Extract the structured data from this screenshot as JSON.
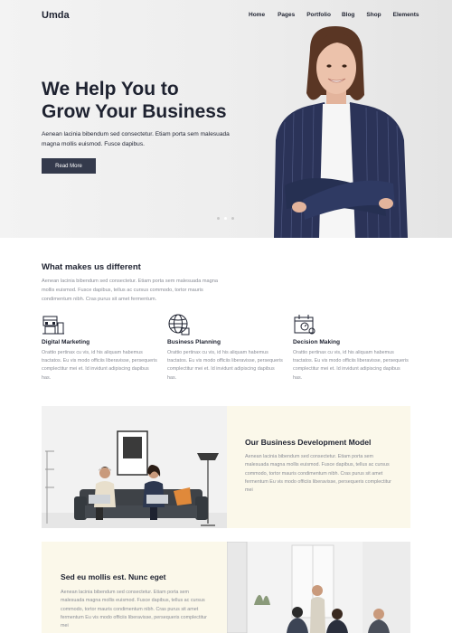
{
  "brand": {
    "logo": "Umda"
  },
  "nav": {
    "items": [
      "Home",
      "Pages",
      "Portfolio",
      "Blog",
      "Shop",
      "Elements"
    ]
  },
  "hero": {
    "title_line1": "We Help You to",
    "title_line2": "Grow Your Business",
    "description": "Aenean lacinia bibendum sed consectetur. Etiam porta sem malesuada magna mollis euismod. Fusce dapibus.",
    "button_label": "Read More"
  },
  "features_section": {
    "title": "What makes us different",
    "description": "Aenean lacinia bibendum sed consectetur. Etiam porta sem malesuada magna mollis euismod. Fusce dapibus, tellus ac cursus commodo, tortor mauris condimentum nibh. Cras purus sit amet fermentum.",
    "items": [
      {
        "title": "Digital Marketing",
        "icon": "store-icon",
        "description": "Orattio pertinax cu vis, id his aliquam habemus tractatos. Eu vis modo officiis liberavisse, persequeris complectitur mei et. Id invidunt adipiscing dapibus has."
      },
      {
        "title": "Business Planning",
        "icon": "globe-icon",
        "description": "Orattio pertinax cu vis, id his aliquam habemus tractatos. Eu vis modo officiis liberavisse, persequeris complectitur mei et. Id invidunt adipiscing dapibus has."
      },
      {
        "title": "Decision Making",
        "icon": "calendar-icon",
        "description": "Orattio pertinax cu vis, id his aliquam habemus tractatos. Eu vis modo officiis liberavisse, persequeris complectitur mei et. Id invidunt adipiscing dapibus has."
      }
    ]
  },
  "block1": {
    "title": "Our Business Development Model",
    "description": "Aenean lacinia bibendum sed consectetur. Etiam porta sem malesuada magna mollis euismod. Fusce dapibus, tellus ac cursus commodo, tortor mauris condimentum nibh. Cras purus sit amet fermentum Eu vis modo officiis liberavisse, persequeris complectitur mei"
  },
  "block2": {
    "title": "Sed eu mollis est. Nunc eget",
    "description": "Aenean lacinia bibendum sed consectetur. Etiam porta sem malesuada magna mollis euismod. Fusce dapibus, tellus ac cursus commodo, tortor mauris condimentum nibh. Cras purus sit amet fermentum Eu vis modo officiis liberavisse, persequeris complectitur mei"
  }
}
